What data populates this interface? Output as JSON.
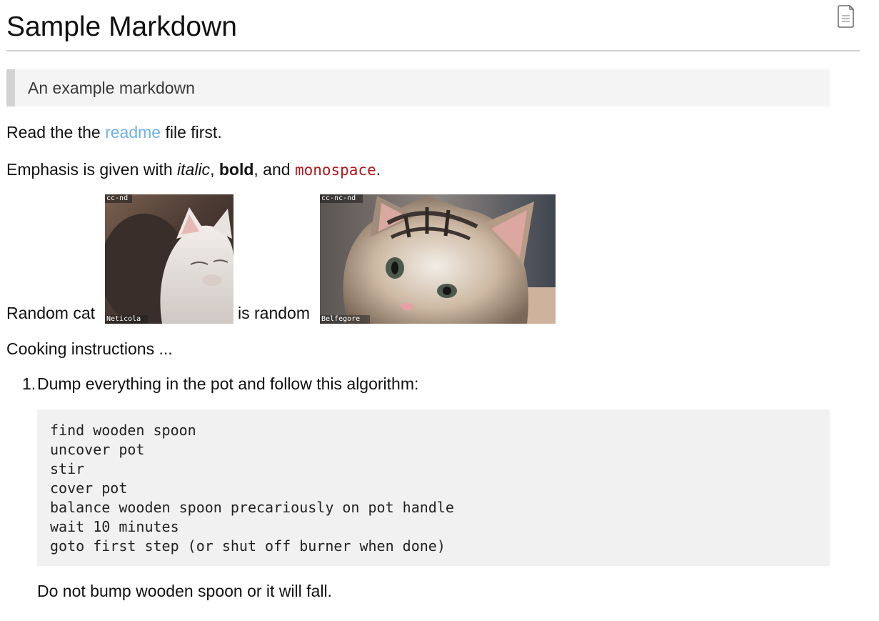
{
  "document": {
    "title": "Sample Markdown",
    "icon": "document-icon"
  },
  "blockquote": {
    "text": "An example markdown"
  },
  "readme_paragraph": {
    "before": "Read the the ",
    "link_text": "readme",
    "after": " file first."
  },
  "emphasis_paragraph": {
    "prefix": "Emphasis is given with ",
    "italic": "italic",
    "sep1": ", ",
    "bold": "bold",
    "sep2": ", and ",
    "monospace": "monospace",
    "end": "."
  },
  "images_paragraph": {
    "before": "Random cat",
    "middle": "is random",
    "image1": {
      "license": "cc-nd",
      "credit": "Neticola"
    },
    "image2": {
      "license": "cc-nc-nd",
      "credit": "Belfegore"
    }
  },
  "cooking": {
    "intro": "Cooking instructions ...",
    "steps": [
      {
        "number": "1.",
        "text": "Dump everything in the pot and follow this algorithm:"
      }
    ],
    "code_lines": [
      "find wooden spoon",
      "uncover pot",
      "stir",
      "cover pot",
      "balance wooden spoon precariously on pot handle",
      "wait 10 minutes",
      "goto first step (or shut off burner when done)"
    ],
    "note": "Do not bump wooden spoon or it will fall."
  },
  "colors": {
    "link": "#6fb1ea",
    "monospace": "#b3161a",
    "blockquote_bg": "#f4f4f4",
    "blockquote_border": "#d2d2d2",
    "code_bg": "#f1f1f1"
  }
}
